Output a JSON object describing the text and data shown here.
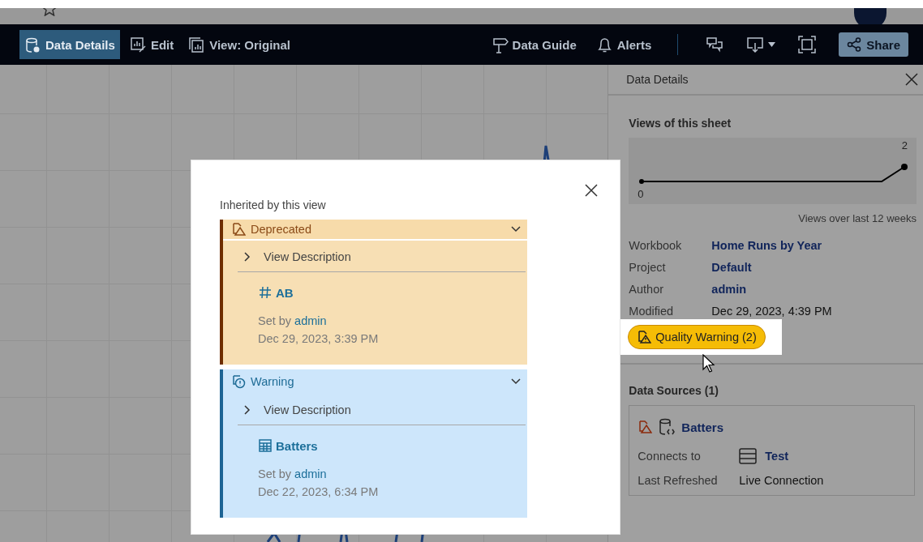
{
  "toolbar": {
    "left": [
      {
        "label": "Data Details",
        "selected": true
      },
      {
        "label": "Edit",
        "selected": false
      },
      {
        "label": "View: Original",
        "selected": false
      }
    ],
    "right": [
      {
        "label": "Data Guide"
      },
      {
        "label": "Alerts"
      }
    ],
    "share": "Share"
  },
  "details_panel": {
    "title": "Data Details",
    "views": {
      "title": "Views of this sheet",
      "start_label": "0",
      "end_label": "2",
      "caption": "Views over last 12 weeks"
    },
    "fields": [
      {
        "label": "Workbook",
        "value": "Home Runs by Year",
        "kind": "link"
      },
      {
        "label": "Project",
        "value": "Default",
        "kind": "link"
      },
      {
        "label": "Author",
        "value": "admin",
        "kind": "link"
      },
      {
        "label": "Modified",
        "value": "Dec 29, 2023, 4:39 PM",
        "kind": "plain"
      }
    ],
    "quality_badge": "Quality Warning (2)",
    "data_sources": {
      "title": "Data Sources (1)",
      "name": "Batters",
      "rows": [
        {
          "label": "Connects to",
          "value": "Test",
          "kind": "link"
        },
        {
          "label": "Last Refreshed",
          "value": "Live Connection",
          "kind": "plain"
        }
      ]
    }
  },
  "popup": {
    "title": "Inherited by this view",
    "warnings": [
      {
        "kind": "deprecated",
        "label": "Deprecated",
        "toggle": "View Description",
        "asset": {
          "kind": "field",
          "name": "AB"
        },
        "set_by_prefix": "Set by",
        "set_by": "admin",
        "date": "Dec 29, 2023, 3:39 PM"
      },
      {
        "kind": "warning",
        "label": "Warning",
        "toggle": "View Description",
        "asset": {
          "kind": "table",
          "name": "Batters"
        },
        "set_by_prefix": "Set by",
        "set_by": "admin",
        "date": "Dec 22, 2023, 6:34 PM"
      }
    ]
  }
}
